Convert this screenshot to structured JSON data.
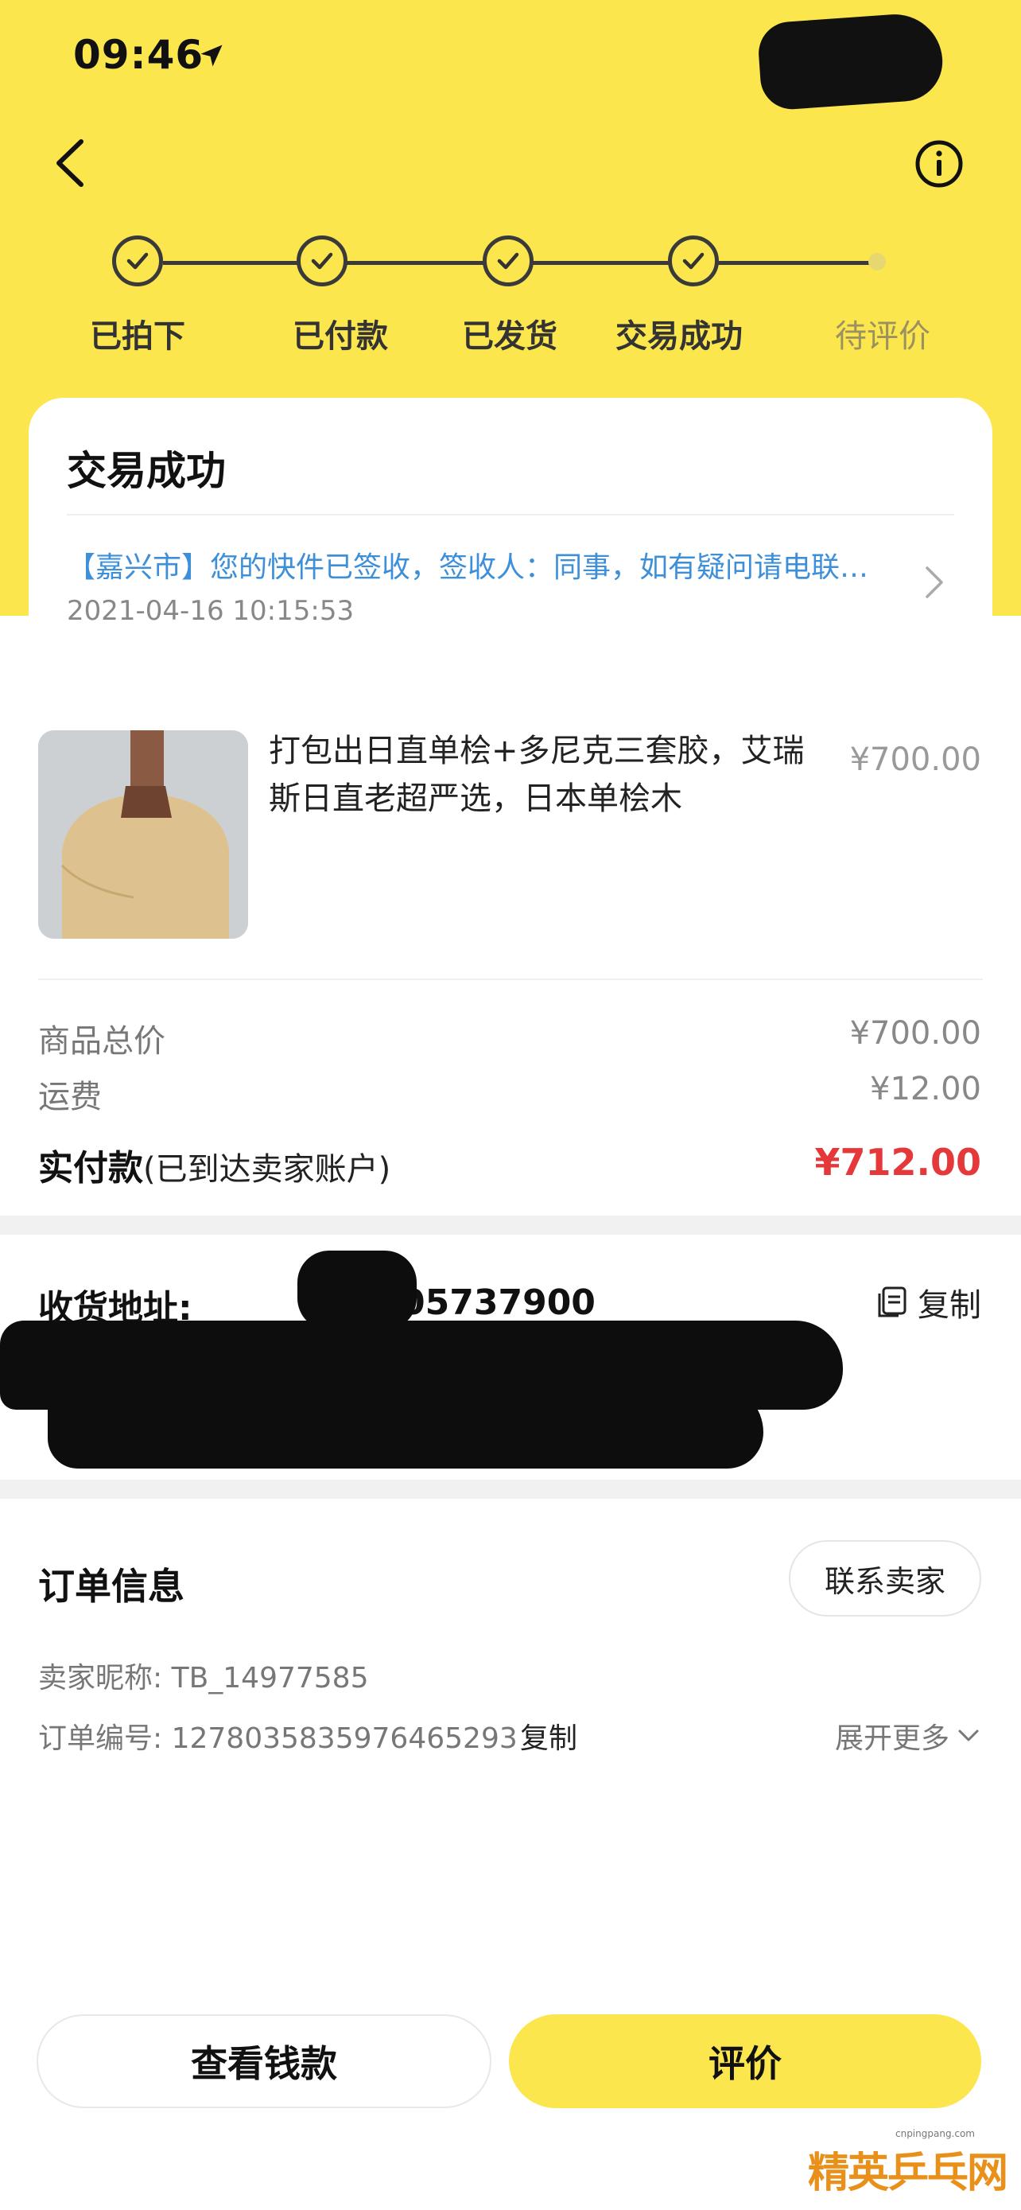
{
  "status_bar": {
    "time": "09:46"
  },
  "steps": [
    {
      "label": "已拍下",
      "done": true
    },
    {
      "label": "已付款",
      "done": true
    },
    {
      "label": "已发货",
      "done": true
    },
    {
      "label": "交易成功",
      "done": true
    },
    {
      "label": "待评价",
      "done": false
    }
  ],
  "status_card": {
    "title": "交易成功",
    "logistics_text": "【嘉兴市】您的快件已签收，签收人：同事，如有疑问请电联…",
    "logistics_time": "2021-04-16 10:15:53"
  },
  "product": {
    "title": "打包出日直单桧+多尼克三套胶，艾瑞斯日直老超严选，日本单桧木",
    "price": "¥700.00"
  },
  "summary": {
    "goods_total_label": "商品总价",
    "goods_total_value": "¥700.00",
    "shipping_label": "运费",
    "shipping_value": "¥12.00",
    "paid_label": "实付款",
    "paid_note": "(已到达卖家账户)",
    "paid_value": "¥712.00"
  },
  "address": {
    "label": "收货地址:",
    "phone_visible": "05737900",
    "copy_label": "复制"
  },
  "order": {
    "title": "订单信息",
    "contact_seller": "联系卖家",
    "seller_nick": "卖家昵称: TB_14977585",
    "order_no": "订单编号: 1278035835976465293",
    "copy_label": "复制",
    "expand_more": "展开更多"
  },
  "actions": {
    "view_payment": "查看钱款",
    "review": "评价"
  },
  "watermark": {
    "text": "精英乒乓网",
    "url": "cnpingpang.com"
  },
  "colors": {
    "brand_yellow": "#fbe64d",
    "price_red": "#e5383a",
    "link_blue": "#3d8fd9"
  }
}
